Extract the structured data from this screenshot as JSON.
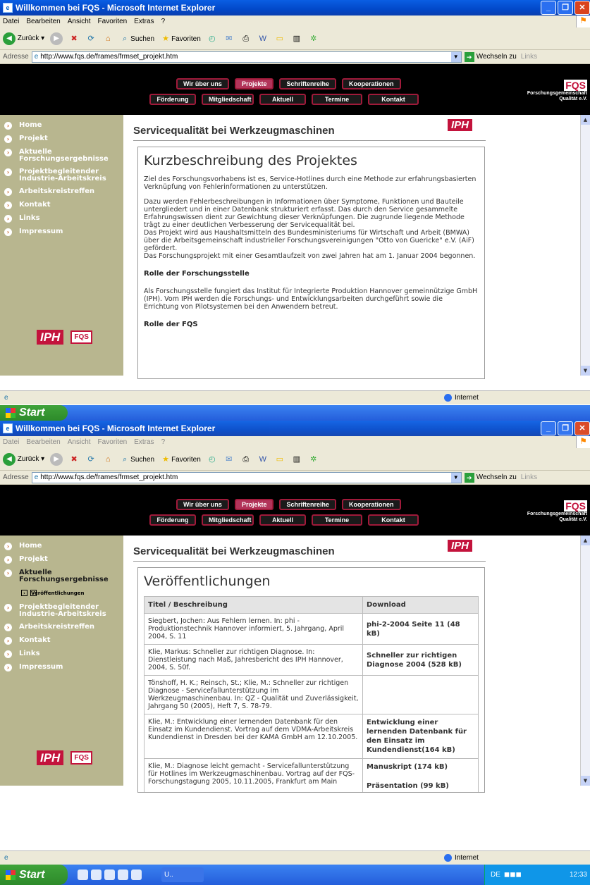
{
  "window": {
    "title": "Willkommen bei FQS - Microsoft Internet Explorer"
  },
  "menu": [
    "Datei",
    "Bearbeiten",
    "Ansicht",
    "Favoriten",
    "Extras",
    "?"
  ],
  "toolbar": {
    "back": "Zurück",
    "search": "Suchen",
    "favorites": "Favoriten"
  },
  "address": {
    "label": "Adresse",
    "url": "http://www.fqs.de/frames/frmset_projekt.htm",
    "go": "Wechseln zu",
    "links": "Links"
  },
  "nav": {
    "row1": [
      "Wir über uns",
      "Projekte",
      "Schriftenreihe",
      "Kooperationen"
    ],
    "row2": [
      "Förderung",
      "Mitgliedschaft",
      "Aktuell",
      "Termine",
      "Kontakt"
    ],
    "active": "Projekte"
  },
  "brand": {
    "logo": "FQS",
    "line1": "Forschungsgemeinschaft",
    "line2": "Qualität e.V."
  },
  "sidebar1": [
    "Home",
    "Projekt",
    "Aktuelle Forschungsergebnisse",
    "Projektbegleitender Industrie-Arbeitskreis",
    "Arbeitskreistreffen",
    "Kontakt",
    "Links",
    "Impressum"
  ],
  "sidebar2": {
    "items": [
      "Home",
      "Projekt",
      "Aktuelle Forschungsergebnisse",
      "Projektbegleitender Industrie-Arbeitskreis",
      "Arbeitskreistreffen",
      "Kontakt",
      "Links",
      "Impressum"
    ],
    "sub": "Veröffentlichungen"
  },
  "logos": {
    "iph": "IPH",
    "fqs": "FQS"
  },
  "content": {
    "title": "Servicequalität bei Werkzeugmaschinen"
  },
  "page1": {
    "heading": "Kurzbeschreibung des Projektes",
    "p1": "Ziel des Forschungsvorhabens ist es, Service-Hotlines durch eine Methode zur erfahrungsbasierten Verknüpfung von Fehlerinformationen zu unterstützen.",
    "p2": "Dazu werden Fehlerbeschreibungen in Informationen über Symptome, Funktionen und Bauteile untergliedert und in einer Datenbank strukturiert erfasst. Das durch den Service gesammelte Erfahrungswissen dient zur Gewichtung dieser Verknüpfungen. Die zugrunde liegende Methode trägt zu einer deutlichen Verbesserung der Servicequalität bei.",
    "p3": "Das Projekt wird aus Haushaltsmitteln des Bundesministeriums für Wirtschaft und Arbeit (BMWA) über die Arbeitsgemeinschaft industrieller Forschungsvereinigungen \"Otto von Guericke\" e.V. (AiF) gefördert.",
    "p4": "Das Forschungsprojekt mit einer Gesamtlaufzeit von zwei Jahren hat am 1. Januar 2004 begonnen.",
    "h2": "Rolle der Forschungsstelle",
    "p5": "Als Forschungsstelle fungiert das Institut für Integrierte Produktion Hannover gemeinnützige GmbH (IPH). Vom IPH werden die Forschungs- und Entwicklungsarbeiten durchgeführt sowie die Errichtung von Pilotsystemen bei den Anwendern betreut.",
    "h3": "Rolle der FQS"
  },
  "page2": {
    "heading": "Veröffentlichungen",
    "col1": "Titel / Beschreibung",
    "col2": "Download",
    "rows": [
      {
        "desc": "Siegbert, Jochen: Aus Fehlern lernen. In: phi - Produktionstechnik Hannover informiert, 5. Jahrgang, April 2004, S. 11",
        "dl": "phi-2-2004 Seite 11 (48 kB)",
        "dl2": ""
      },
      {
        "desc": "Klie, Markus: Schneller zur richtigen Diagnose. In: Dienstleistung nach Maß, Jahresbericht des IPH Hannover, 2004, S. 50f.",
        "dl": "Schneller zur richtigen Diagnose 2004 (528 kB)",
        "dl2": ""
      },
      {
        "desc": "Tönshoff, H. K.; Reinsch, St.; Klie, M.: Schneller zur richtigen Diagnose - Servicefallunterstützung im Werkzeugmaschinenbau. In: QZ - Qualität und Zuverlässigkeit, Jahrgang 50 (2005), Heft 7, S. 78-79.",
        "dl": "",
        "dl2": ""
      },
      {
        "desc": "Klie, M.: Entwicklung einer lernenden Datenbank für den Einsatz im Kundendienst. Vortrag auf dem VDMA-Arbeitskreis Kundendienst in Dresden bei der KAMA GmbH am 12.10.2005.",
        "dl": "Entwicklung einer lernenden Datenbank für den Einsatz im Kundendienst(164 kB)",
        "dl2": ""
      },
      {
        "desc": "Klie, M.: Diagnose leicht gemacht - Servicefallunterstützung für Hotlines im Werkzeugmaschinenbau. Vortrag auf der FQS-Forschungstagung 2005, 10.11.2005, Frankfurt am Main",
        "dl": "Manuskript (174 kB)",
        "dl2": "Präsentation (99 kB)"
      }
    ]
  },
  "status": {
    "zone": "Internet"
  },
  "taskbar": {
    "start": "Start",
    "task": "U..",
    "lang": "DE",
    "clock": "12:33"
  }
}
